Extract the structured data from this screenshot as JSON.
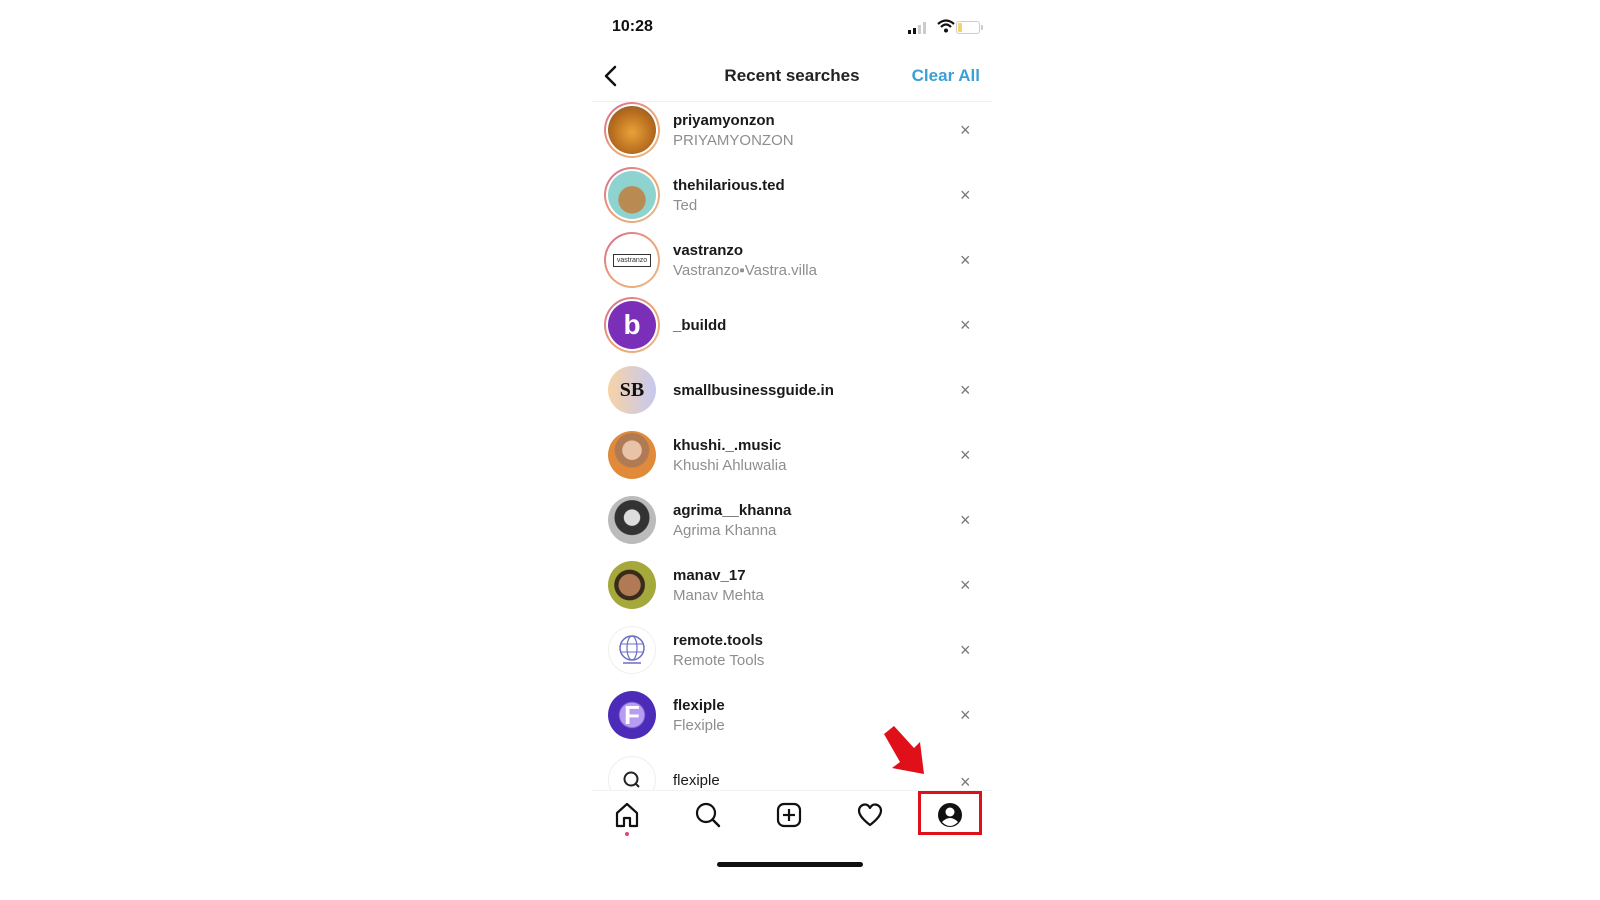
{
  "status_bar": {
    "time": "10:28",
    "battery_level": 0.2
  },
  "header": {
    "back_icon": "chevron-left-icon",
    "title": "Recent searches",
    "clear_all_label": "Clear All",
    "accent_color": "#3aa0d6"
  },
  "recent_searches": [
    {
      "username": "priyamyonzon",
      "full_name": "PRIYAMYONZON",
      "story_ring": true,
      "avatar": "orange-cat-photo"
    },
    {
      "username": "thehilarious.ted",
      "full_name": "Ted",
      "story_ring": true,
      "avatar": "teddy-bear-photo"
    },
    {
      "username": "vastranzo",
      "full_name": "Vastranzo▪Vastra.villa",
      "story_ring": true,
      "avatar": "vastranzo-logo",
      "avatar_text": "vastranzo"
    },
    {
      "username": "_buildd",
      "full_name": "",
      "story_ring": true,
      "avatar": "purple-b-logo",
      "avatar_text": "b"
    },
    {
      "username": "smallbusinessguide.in",
      "full_name": "",
      "story_ring": false,
      "avatar": "sb-logo",
      "avatar_text": "SB"
    },
    {
      "username": "khushi._.music",
      "full_name": "Khushi Ahluwalia",
      "story_ring": false,
      "avatar": "woman-photo"
    },
    {
      "username": "agrima__khanna",
      "full_name": "Agrima Khanna",
      "story_ring": false,
      "avatar": "bw-woman-photo"
    },
    {
      "username": "manav_17",
      "full_name": "Manav Mehta",
      "story_ring": false,
      "avatar": "man-sunglasses-photo"
    },
    {
      "username": "remote.tools",
      "full_name": "Remote Tools",
      "story_ring": false,
      "avatar": "globe-logo"
    },
    {
      "username": "flexiple",
      "full_name": "Flexiple",
      "story_ring": false,
      "avatar": "flexiple-f-logo",
      "avatar_text": "F"
    },
    {
      "username": "flexiple",
      "full_name": "",
      "story_ring": false,
      "avatar": "search-query-icon"
    }
  ],
  "remove_label": "×",
  "tab_bar": {
    "tabs": [
      "home",
      "search",
      "new-post",
      "activity",
      "profile"
    ],
    "active_tab": "home",
    "highlighted_tab": "profile",
    "highlight_color": "#e0101a"
  }
}
